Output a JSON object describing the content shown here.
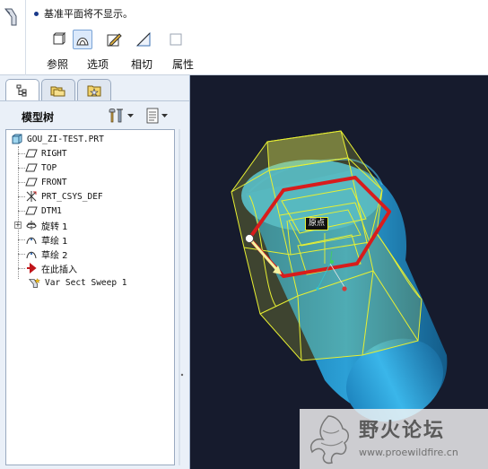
{
  "dashboard": {
    "message": "基准平面将不显示。",
    "tabs": [
      {
        "label": "参照"
      },
      {
        "label": "选项"
      },
      {
        "label": "相切"
      },
      {
        "label": "属性"
      }
    ]
  },
  "model_tree": {
    "title": "模型树",
    "items": [
      {
        "label": "GOU_ZI-TEST.PRT",
        "icon": "part-icon"
      },
      {
        "label": "RIGHT",
        "icon": "datum-plane-icon"
      },
      {
        "label": "TOP",
        "icon": "datum-plane-icon"
      },
      {
        "label": "FRONT",
        "icon": "datum-plane-icon"
      },
      {
        "label": "PRT_CSYS_DEF",
        "icon": "csys-icon"
      },
      {
        "label": "DTM1",
        "icon": "datum-plane-icon"
      },
      {
        "label": "旋转 1",
        "icon": "revolve-icon"
      },
      {
        "label": "草绘 1",
        "icon": "sketch-icon"
      },
      {
        "label": "草绘 2",
        "icon": "sketch-icon"
      },
      {
        "label": "在此插入",
        "icon": "insert-arrow-icon"
      },
      {
        "label": "Var Sect Sweep 1",
        "icon": "sweep-icon"
      }
    ]
  },
  "viewport": {
    "origin_label": "原点"
  },
  "watermark": {
    "title": "野火论坛",
    "url": "www.proewildfire.cn"
  },
  "colors": {
    "viewport_bg": "#161b2d",
    "cylinder": "#2aa3d8",
    "preview_yellow": "#e8f032",
    "trajectory_red": "#d81c1c",
    "brand_red": "#c0392b"
  }
}
